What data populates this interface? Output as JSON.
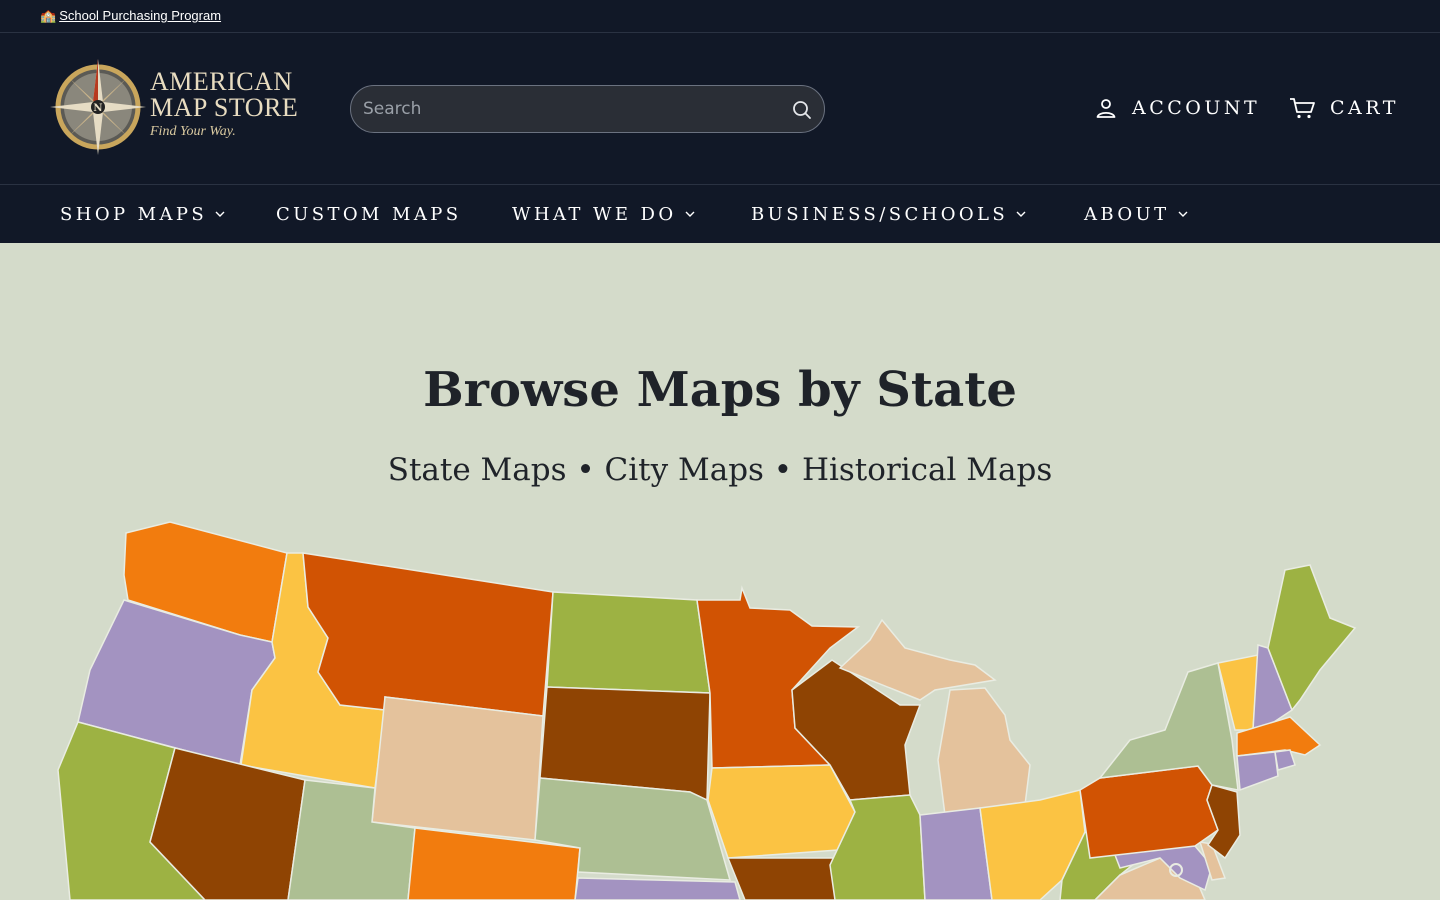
{
  "topbar": {
    "emoji": "🏫",
    "link": "School Purchasing Program"
  },
  "logo": {
    "line1": "AMERICAN",
    "line2": "MAP STORE",
    "tagline": "Find Your Way.",
    "compass_letter": "N"
  },
  "search": {
    "placeholder": "Search"
  },
  "header": {
    "account": "ACCOUNT",
    "cart": "CART"
  },
  "nav": [
    {
      "label": "SHOP MAPS",
      "dropdown": true
    },
    {
      "label": "CUSTOM MAPS",
      "dropdown": false
    },
    {
      "label": "WHAT WE DO",
      "dropdown": true
    },
    {
      "label": "BUSINESS/SCHOOLS",
      "dropdown": true
    },
    {
      "label": "ABOUT",
      "dropdown": true
    }
  ],
  "hero": {
    "title": "Browse Maps by State",
    "subtitle": "State Maps • City Maps • Historical Maps"
  },
  "colors": {
    "dark_bg": "#111827",
    "page_bg": "#d4dbca",
    "orange": "#f27c0e",
    "burnt": "#d15303",
    "brown": "#8f4403",
    "yellow": "#fbc343",
    "tan": "#e4c29c",
    "purple": "#a393c1",
    "green": "#9db243",
    "sage": "#adbf93"
  }
}
